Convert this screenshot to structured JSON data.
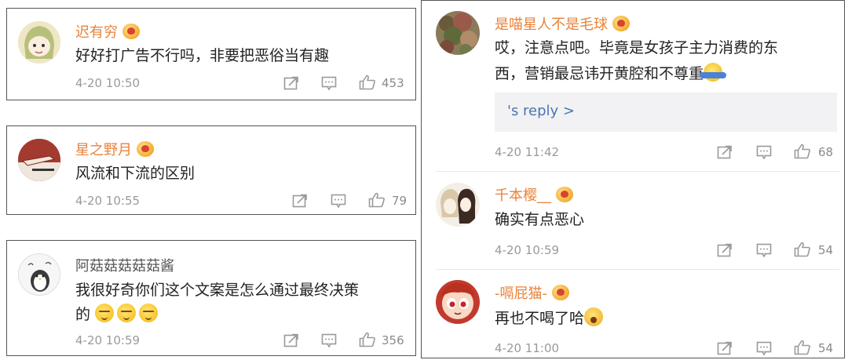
{
  "left_comments": [
    {
      "username": "迟有穷",
      "vip": true,
      "text_lines": [
        "好好打广告不行吗，非要把恶俗当有趣"
      ],
      "time": "4-20 10:50",
      "likes": "453",
      "avatar": "cartoon-girl-avatar"
    },
    {
      "username": "星之野月",
      "vip": true,
      "text_lines": [
        "风流和下流的区别"
      ],
      "time": "4-20 10:55",
      "likes": "79",
      "avatar": "drawing-hand-avatar"
    },
    {
      "username": "阿菇菇菇菇菇酱",
      "vip": false,
      "text_lines": [
        "我很好奇你们这个文案是怎么通过最终决策",
        "的"
      ],
      "emojis": [
        "sleepy-emoji",
        "sleepy-emoji",
        "sleepy-emoji"
      ],
      "time": "4-20 10:59",
      "likes": "356",
      "avatar": "penguin-avatar"
    }
  ],
  "right_comments": [
    {
      "username": "是喵星人不是毛球",
      "vip": true,
      "text_lines": [
        "哎，注意点吧。毕竟是女孩子主力消费的东",
        "西，营销最忌讳开黄腔和不尊重"
      ],
      "emojis": [
        "shrug-emoji"
      ],
      "reply_link": "'s reply >",
      "time": "4-20 11:42",
      "likes": "68",
      "avatar": "tree-landscape-avatar"
    },
    {
      "username": "千本樱__",
      "vip": true,
      "text_lines": [
        "确实有点恶心"
      ],
      "time": "4-20 10:59",
      "likes": "54",
      "avatar": "anime-couple-avatar"
    },
    {
      "username": "-嗝屁猫-",
      "vip": true,
      "text_lines": [
        "再也不喝了哈"
      ],
      "emojis": [
        "scared-emoji"
      ],
      "time": "4-20 11:00",
      "likes": "54",
      "avatar": "powerpuff-avatar"
    }
  ],
  "icons": {
    "share": "share-icon",
    "comment": "comment-icon",
    "like": "thumbs-up-icon"
  },
  "colors": {
    "username": "#e8823a",
    "reply_link": "#4a76b3",
    "meta_gray": "#9a9a9a"
  }
}
